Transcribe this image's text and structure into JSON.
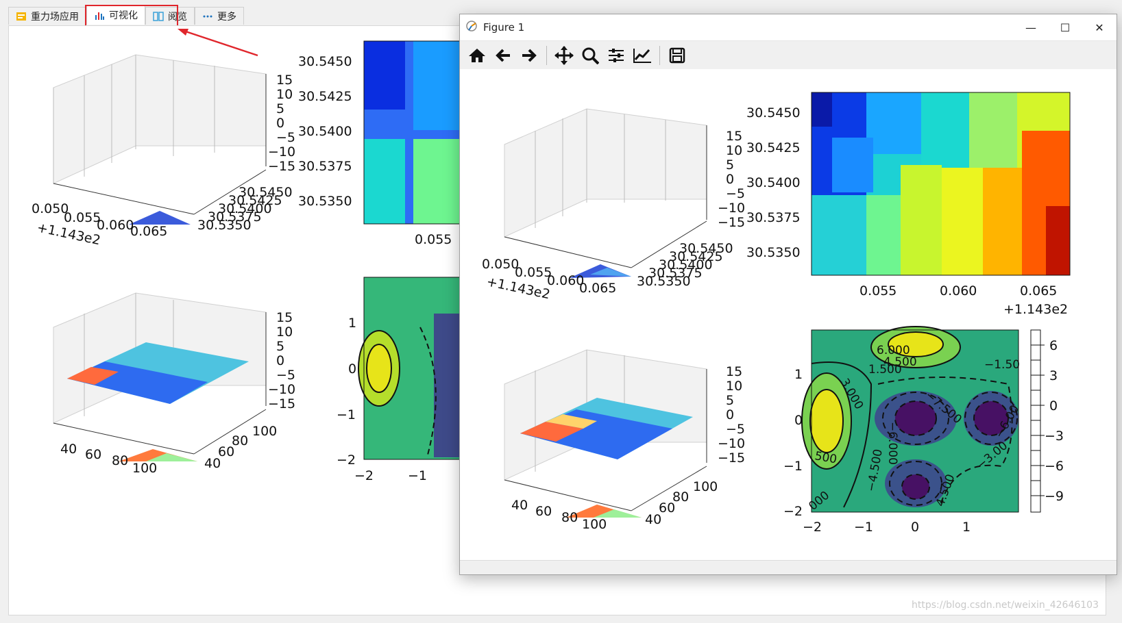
{
  "tabs": [
    {
      "label": "重力场应用",
      "icon": "app-icon"
    },
    {
      "label": "可视化",
      "icon": "bar-chart-icon"
    },
    {
      "label": "阅览",
      "icon": "book-icon"
    },
    {
      "label": "更多",
      "icon": "more-dots-icon"
    }
  ],
  "figure": {
    "title": "Figure 1",
    "buttons": [
      "home",
      "back",
      "forward",
      "pan",
      "zoom",
      "configure",
      "edit-axes",
      "save"
    ]
  },
  "axes3d_top": {
    "z_ticks": [
      "15",
      "10",
      "5",
      "0",
      "−5",
      "−10",
      "−15"
    ],
    "y_ticks": [
      "30.5450",
      "30.5425",
      "30.5400",
      "30.5375",
      "30.5350"
    ],
    "x_ticks": [
      "0.050",
      "0.055",
      "0.060",
      "0.065"
    ],
    "x_offset": "+1.143e2"
  },
  "axes3d_bottom": {
    "z_ticks": [
      "15",
      "10",
      "5",
      "0",
      "−5",
      "−10",
      "−15"
    ],
    "y_ticks": [
      "100",
      "80",
      "60",
      "40"
    ],
    "x_ticks": [
      "40",
      "60",
      "80",
      "100"
    ]
  },
  "heatmap": {
    "y_ticks": [
      "30.5450",
      "30.5425",
      "30.5400",
      "30.5375",
      "30.5350"
    ],
    "x_ticks": [
      "0.055",
      "0.060",
      "0.065"
    ],
    "x_offset": "+1.143e2"
  },
  "contour": {
    "y_ticks": [
      "1",
      "0",
      "−1",
      "−2"
    ],
    "x_ticks": [
      "−2",
      "−1",
      "0",
      "1"
    ],
    "colorbar_ticks": [
      "6",
      "3",
      "0",
      "−3",
      "−6",
      "−9"
    ],
    "labels": [
      "6.000",
      "4.500",
      "3.000",
      "1.500",
      "−1.50",
      "−7.500",
      "−6.000",
      "−4.500",
      "−3.00",
      "−6.00",
      "4.500",
      "000",
      "500"
    ]
  },
  "watermark": "https://blog.csdn.net/weixin_42646103",
  "colors": {
    "highlight": "#e0262c",
    "accent": "#1e73be"
  }
}
